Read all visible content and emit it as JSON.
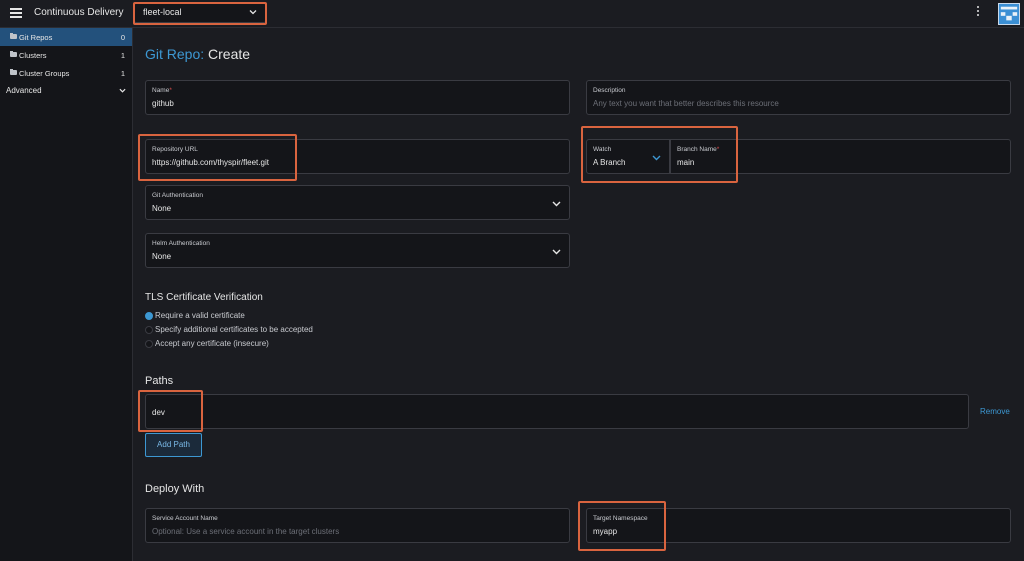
{
  "header": {
    "app_title": "Continuous Delivery",
    "workspace": "fleet-local"
  },
  "sidebar": {
    "items": [
      {
        "label": "Git Repos",
        "count": "0"
      },
      {
        "label": "Clusters",
        "count": "1"
      },
      {
        "label": "Cluster Groups",
        "count": "1"
      }
    ],
    "advanced_label": "Advanced"
  },
  "page": {
    "title_prefix": "Git Repo:",
    "title_action": "Create"
  },
  "form": {
    "name": {
      "label": "Name",
      "required_mark": "*",
      "value": "github"
    },
    "description": {
      "label": "Description",
      "placeholder": "Any text you want that better describes this resource"
    },
    "repo_url": {
      "label": "Repository URL",
      "value": "https://github.com/thyspir/fleet.git"
    },
    "watch": {
      "label": "Watch",
      "value": "A Branch"
    },
    "branch": {
      "label": "Branch Name",
      "required_mark": "*",
      "value": "main"
    },
    "git_auth": {
      "label": "Git Authentication",
      "value": "None"
    },
    "helm_auth": {
      "label": "Helm Authentication",
      "value": "None"
    }
  },
  "tls": {
    "title": "TLS Certificate Verification",
    "options": [
      {
        "label": "Require a valid certificate",
        "selected": true
      },
      {
        "label": "Specify additional certificates to be accepted",
        "selected": false
      },
      {
        "label": "Accept any certificate (insecure)",
        "selected": false
      }
    ]
  },
  "paths": {
    "title": "Paths",
    "value": "dev",
    "remove_label": "Remove",
    "add_label": "Add Path"
  },
  "deploy": {
    "title": "Deploy With",
    "service_account": {
      "label": "Service Account Name",
      "placeholder": "Optional: Use a service account in the target clusters"
    },
    "namespace": {
      "label": "Target Namespace",
      "value": "myapp"
    }
  },
  "colors": {
    "accent": "#3d98d3",
    "highlight": "#d9643f",
    "background": "#1b1c21",
    "sidebar_active": "#23517c"
  }
}
